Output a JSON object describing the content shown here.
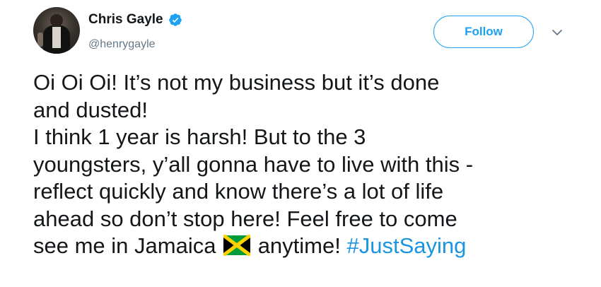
{
  "user": {
    "display_name": "Chris Gayle",
    "handle": "@henrygayle",
    "verified": true
  },
  "actions": {
    "follow_label": "Follow"
  },
  "tweet": {
    "lines": [
      "Oi Oi Oi! It’s not my business but it’s done",
      "and dusted!",
      "I think 1 year is harsh! But to the 3",
      "youngsters, y’all gonna have to live with this -",
      "reflect quickly and know there’s a lot of life",
      "ahead so don’t stop here! Feel free to come"
    ],
    "last_line_before_flag": "see me in Jamaica",
    "last_line_after_flag": " anytime! ",
    "hashtag": "#JustSaying",
    "flag_emoji": "jamaica-flag"
  },
  "colors": {
    "accent": "#1da1f2",
    "hashtag": "#1b95e0",
    "text": "#14171a",
    "secondary": "#657786"
  },
  "icons": {
    "verified": "verified-badge-icon",
    "caret": "chevron-down-icon"
  }
}
